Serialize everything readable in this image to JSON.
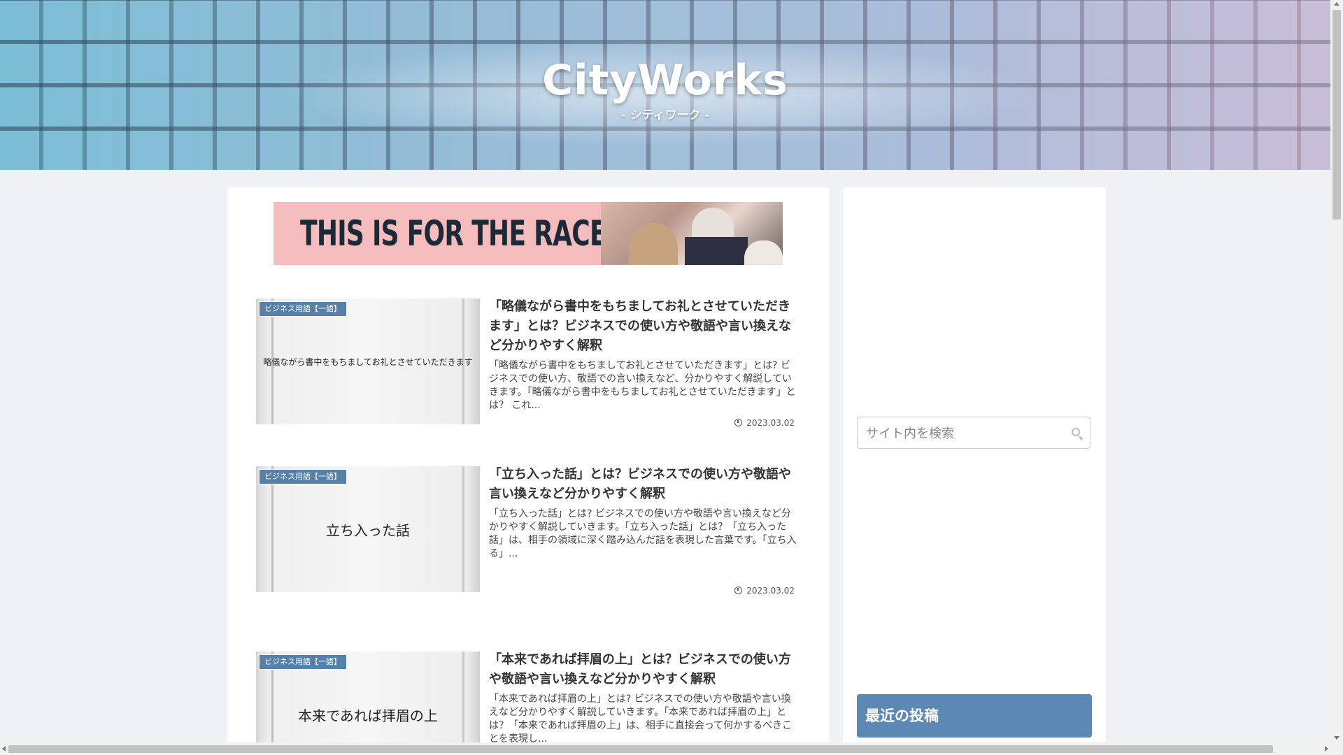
{
  "header": {
    "title": "CityWorks",
    "subtitle": "- シティワーク -"
  },
  "banner": {
    "text": "THIS IS FOR THE RACE LOVERS"
  },
  "articles": [
    {
      "category": "ビジネス用語【一語】",
      "thumb_text": "略儀ながら書中をもちましてお礼とさせていただきます",
      "title": "「略儀ながら書中をもちましてお礼とさせていただきます」とは？ビジネスでの使い方や敬語や言い換えなど分かりやすく解釈",
      "excerpt": "「略儀ながら書中をもちましてお礼とさせていただきます」とは? ビジネスでの使い方、敬語での言い換えなど、分かりやすく解説していきます。「略儀ながら書中をもちましてお礼とさせていただきます」とは？ これ...",
      "date": "2023.03.02"
    },
    {
      "category": "ビジネス用語【一語】",
      "thumb_text": "立ち入った話",
      "title": "「立ち入った話」とは？ビジネスでの使い方や敬語や言い換えなど分かりやすく解釈",
      "excerpt": "「立ち入った話」とは? ビジネスでの使い方や敬語や言い換えなど分かりやすく解説していきます。「立ち入った話」とは？「立ち入った話」は、相手の領域に深く踏み込んだ話を表現した言葉です。「立ち入る」...",
      "date": "2023.03.02"
    },
    {
      "category": "ビジネス用語【一語】",
      "thumb_text": "本来であれば拝眉の上",
      "title": "「本来であれば拝眉の上」とは？ビジネスでの使い方や敬語や言い換えなど分かりやすく解釈",
      "excerpt": "「本来であれば拝眉の上」とは? ビジネスでの使い方や敬語や言い換えなど分かりやすく解説していきます。「本来であれば拝眉の上」とは？「本来であれば拝眉の上」は、相手に直接会って何かするべきことを表現し...",
      "date": ""
    }
  ],
  "sidebar": {
    "search_placeholder": "サイト内を検索",
    "recent_heading": "最近の投稿"
  },
  "colors": {
    "accent": "#5b88b5",
    "badge": "#5580a8",
    "page_bg": "#eff1f5"
  }
}
